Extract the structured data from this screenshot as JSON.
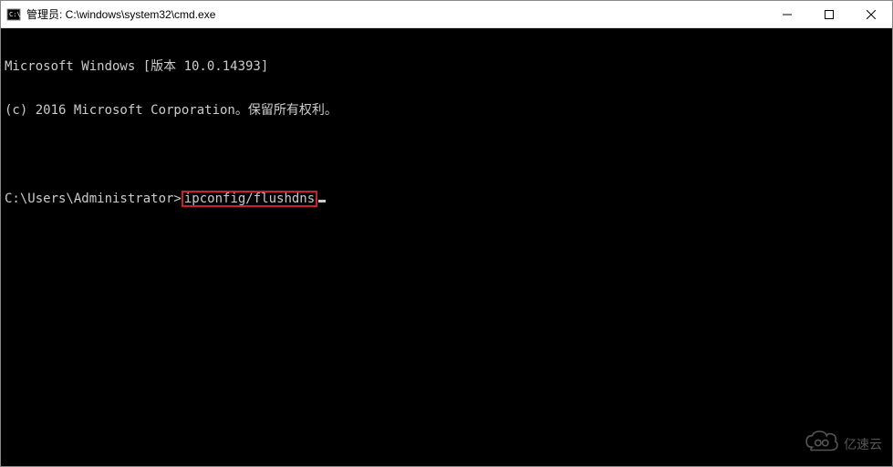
{
  "window": {
    "title": "管理员: C:\\windows\\system32\\cmd.exe"
  },
  "terminal": {
    "line1": "Microsoft Windows [版本 10.0.14393]",
    "line2": "(c) 2016 Microsoft Corporation。保留所有权利。",
    "prompt": "C:\\Users\\Administrator>",
    "command": "ipconfig/flushdns"
  },
  "watermark": {
    "text": "亿速云"
  }
}
